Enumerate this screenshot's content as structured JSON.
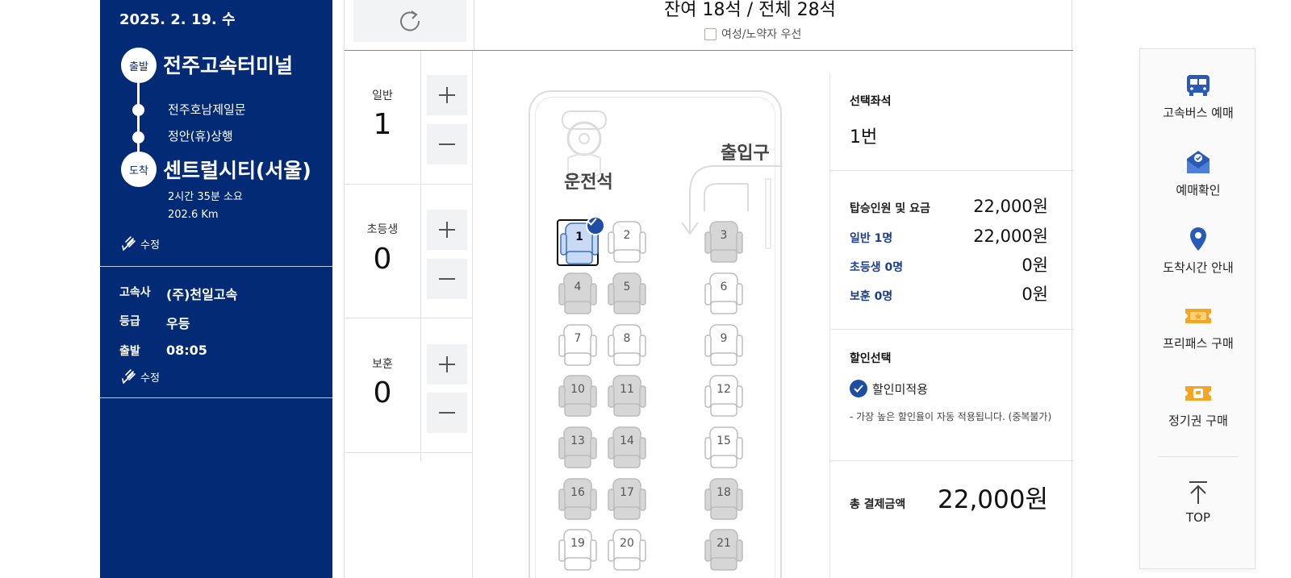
{
  "trip": {
    "date": "2025. 2. 19. 수",
    "depart_badge": "출발",
    "depart_name": "전주고속터미널",
    "via": [
      "전주호남제일문",
      "정안(휴)상행"
    ],
    "arrive_badge": "도착",
    "arrive_name": "센트럴시티(서울)",
    "duration": "2시간 35분 소요",
    "distance": "202.6 Km",
    "edit_label": "수정"
  },
  "bus_info": {
    "company_label": "고속사",
    "company": "(주)천일고속",
    "grade_label": "등급",
    "grade": "우등",
    "depart_label": "출발",
    "depart_time": "08:05",
    "edit_label": "수정"
  },
  "seat_header": {
    "count_text": "잔여 18석 / 전체 28석",
    "priority_label": "여성/노약자 우선"
  },
  "passengers": [
    {
      "label": "일반",
      "count": "1"
    },
    {
      "label": "초등생",
      "count": "0"
    },
    {
      "label": "보훈",
      "count": "0"
    }
  ],
  "bus_map": {
    "driver_label": "운전석",
    "entrance_label": "출입구",
    "seats": [
      {
        "num": "1",
        "state": "selected"
      },
      {
        "num": "2",
        "state": "available"
      },
      {
        "num": "3",
        "state": "taken"
      },
      {
        "num": "4",
        "state": "taken"
      },
      {
        "num": "5",
        "state": "taken"
      },
      {
        "num": "6",
        "state": "available"
      },
      {
        "num": "7",
        "state": "available"
      },
      {
        "num": "8",
        "state": "available"
      },
      {
        "num": "9",
        "state": "available"
      },
      {
        "num": "10",
        "state": "taken"
      },
      {
        "num": "11",
        "state": "taken"
      },
      {
        "num": "12",
        "state": "available"
      },
      {
        "num": "13",
        "state": "taken"
      },
      {
        "num": "14",
        "state": "taken"
      },
      {
        "num": "15",
        "state": "available"
      },
      {
        "num": "16",
        "state": "taken"
      },
      {
        "num": "17",
        "state": "taken"
      },
      {
        "num": "18",
        "state": "taken"
      },
      {
        "num": "19",
        "state": "available"
      },
      {
        "num": "20",
        "state": "available"
      },
      {
        "num": "21",
        "state": "taken"
      }
    ]
  },
  "summary": {
    "selected_title": "선택좌석",
    "selected_value": "1번",
    "fare_title": "탑승인원 및 요금",
    "fare_total": "22,000원",
    "fares": [
      {
        "label": "일반 1명",
        "value": "22,000원"
      },
      {
        "label": "초등생 0명",
        "value": "0원"
      },
      {
        "label": "보훈 0명",
        "value": "0원"
      }
    ],
    "discount_title": "할인선택",
    "discount_option": "할인미적용",
    "discount_note": "- 가장 높은 할인율이 자동 적용됩니다. (중복불가)",
    "total_label": "총 결제금액",
    "total_value": "22,000원"
  },
  "quick_menu": [
    {
      "label": "고속버스 예매",
      "icon": "bus-icon"
    },
    {
      "label": "예매확인",
      "icon": "mail-check-icon"
    },
    {
      "label": "도착시간 안내",
      "icon": "location-pin-icon"
    },
    {
      "label": "프리패스 구매",
      "icon": "freepass-ticket-icon"
    },
    {
      "label": "정기권 구매",
      "icon": "season-ticket-icon"
    }
  ],
  "top_label": "TOP",
  "colors": {
    "brand_navy": "#032b75",
    "accent_blue": "#1d4ea3",
    "priority_orange": "#f0a81a",
    "icon_orange": "#f4a623"
  }
}
